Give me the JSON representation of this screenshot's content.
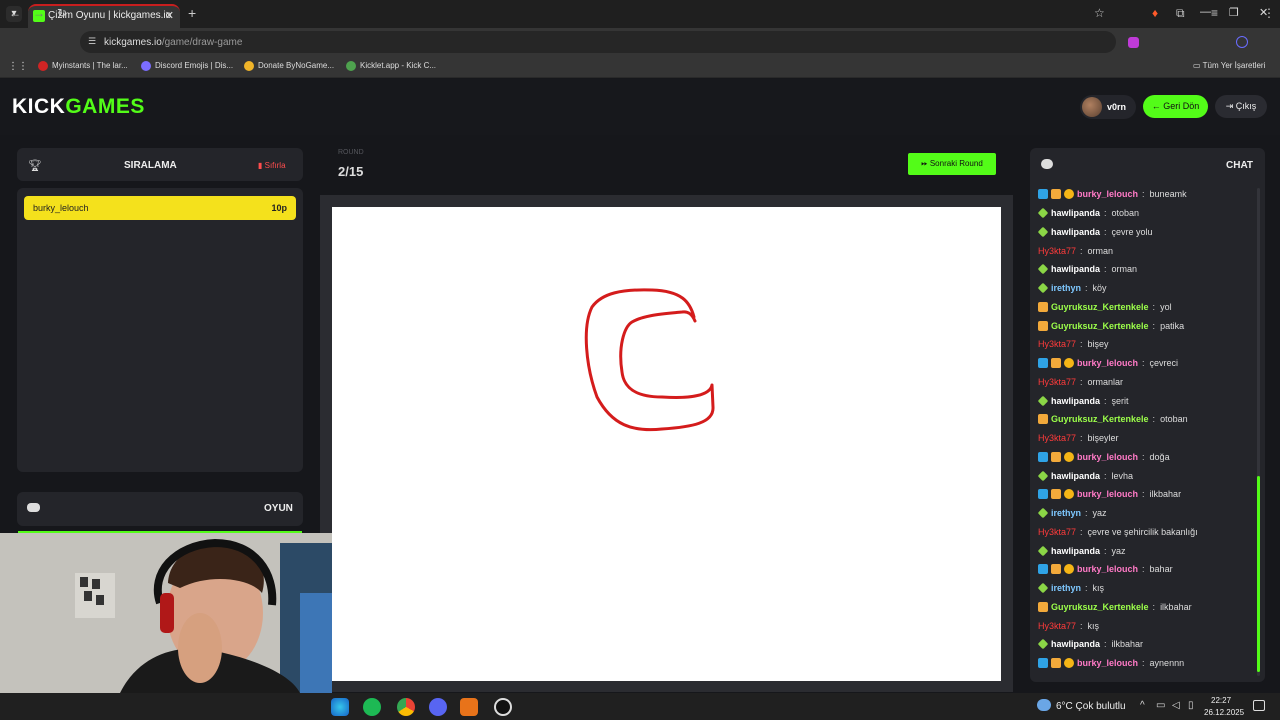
{
  "browser": {
    "tab_title": "Çizim Oyunu | kickgames.io",
    "url_host": "kickgames.io",
    "url_path": "/game/draw-game",
    "bookmarks": [
      "Myinstants | The lar...",
      "Discord Emojis | Dis...",
      "Donate ByNoGame...",
      "Kicklet.app - Kick C..."
    ],
    "all_bookmarks": "Tüm Yer İşaretleri"
  },
  "header": {
    "logo_part1": "KICK",
    "logo_part2": "GAMES",
    "username": "v0rn",
    "back_label": "Geri Dön",
    "exit_label": "Çıkış"
  },
  "leaderboard": {
    "title": "SIRALAMA",
    "clear_label": "Sıfırla",
    "entries": [
      {
        "name": "burky_lelouch",
        "points": "10p"
      }
    ]
  },
  "game_panel": {
    "title": "OYUN"
  },
  "round": {
    "label": "ROUND",
    "count": "2/15",
    "next_label": "Sonraki Round"
  },
  "chat": {
    "title": "CHAT",
    "messages": [
      {
        "user": "burky_lelouch",
        "color": "#ff7ac6",
        "badges": [
          "blue",
          "crown",
          "coin"
        ],
        "text": "buneamk"
      },
      {
        "user": "hawlipanda",
        "color": "#ffffff",
        "badges": [
          "star"
        ],
        "text": "otoban"
      },
      {
        "user": "hawlipanda",
        "color": "#ffffff",
        "badges": [
          "star"
        ],
        "text": "çevre yolu"
      },
      {
        "user": "Hy3kta77",
        "color": "#ff3b3b",
        "badges": [],
        "text": "orman"
      },
      {
        "user": "hawlipanda",
        "color": "#ffffff",
        "badges": [
          "star"
        ],
        "text": "orman"
      },
      {
        "user": "irethyn",
        "color": "#7ec8ff",
        "badges": [
          "star"
        ],
        "text": "köy"
      },
      {
        "user": "Guyruksuz_Kertenkele",
        "color": "#9cff4a",
        "badges": [
          "crown"
        ],
        "text": "yol"
      },
      {
        "user": "Guyruksuz_Kertenkele",
        "color": "#9cff4a",
        "badges": [
          "crown"
        ],
        "text": "patika"
      },
      {
        "user": "Hy3kta77",
        "color": "#ff3b3b",
        "badges": [],
        "text": "bişey"
      },
      {
        "user": "burky_lelouch",
        "color": "#ff7ac6",
        "badges": [
          "blue",
          "crown",
          "coin"
        ],
        "text": "çevreci"
      },
      {
        "user": "Hy3kta77",
        "color": "#ff3b3b",
        "badges": [],
        "text": "ormanlar"
      },
      {
        "user": "hawlipanda",
        "color": "#ffffff",
        "badges": [
          "star"
        ],
        "text": "şerit"
      },
      {
        "user": "Guyruksuz_Kertenkele",
        "color": "#9cff4a",
        "badges": [
          "crown"
        ],
        "text": "otoban"
      },
      {
        "user": "Hy3kta77",
        "color": "#ff3b3b",
        "badges": [],
        "text": "bişeyler"
      },
      {
        "user": "burky_lelouch",
        "color": "#ff7ac6",
        "badges": [
          "blue",
          "crown",
          "coin"
        ],
        "text": "doğa"
      },
      {
        "user": "hawlipanda",
        "color": "#ffffff",
        "badges": [
          "star"
        ],
        "text": "levha"
      },
      {
        "user": "burky_lelouch",
        "color": "#ff7ac6",
        "badges": [
          "blue",
          "crown",
          "coin"
        ],
        "text": "ilkbahar"
      },
      {
        "user": "irethyn",
        "color": "#7ec8ff",
        "badges": [
          "star"
        ],
        "text": "yaz"
      },
      {
        "user": "Hy3kta77",
        "color": "#ff3b3b",
        "badges": [],
        "text": "çevre ve şehircilik bakanlığı"
      },
      {
        "user": "hawlipanda",
        "color": "#ffffff",
        "badges": [
          "star"
        ],
        "text": "yaz"
      },
      {
        "user": "burky_lelouch",
        "color": "#ff7ac6",
        "badges": [
          "blue",
          "crown",
          "coin"
        ],
        "text": "bahar"
      },
      {
        "user": "irethyn",
        "color": "#7ec8ff",
        "badges": [
          "star"
        ],
        "text": "kış"
      },
      {
        "user": "Guyruksuz_Kertenkele",
        "color": "#9cff4a",
        "badges": [
          "crown"
        ],
        "text": "ilkbahar"
      },
      {
        "user": "Hy3kta77",
        "color": "#ff3b3b",
        "badges": [],
        "text": "kış"
      },
      {
        "user": "hawlipanda",
        "color": "#ffffff",
        "badges": [
          "star"
        ],
        "text": "ilkbahar"
      },
      {
        "user": "burky_lelouch",
        "color": "#ff7ac6",
        "badges": [
          "blue",
          "crown",
          "coin"
        ],
        "text": "aynennn"
      }
    ]
  },
  "taskbar": {
    "weather": "6°C  Çok bulutlu",
    "time": "22:27",
    "date": "26.12.2025"
  },
  "colors": {
    "accent": "#53fc18",
    "leader_highlight": "#f4e11c",
    "drawing_stroke": "#d41c1c"
  }
}
